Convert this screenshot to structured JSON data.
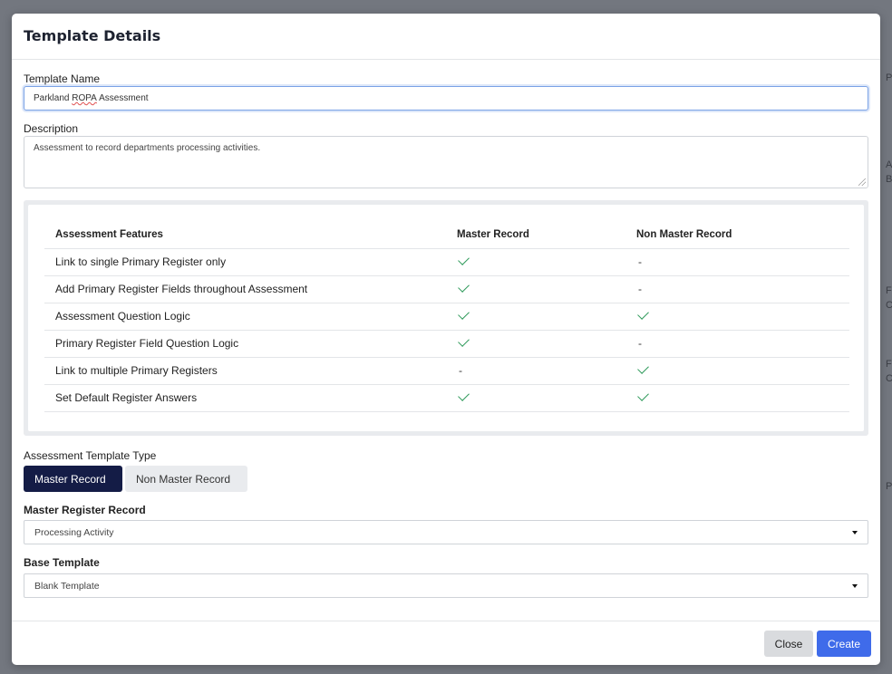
{
  "modal": {
    "title": "Template Details"
  },
  "template_name": {
    "label": "Template Name",
    "value_pre": "Parkland ",
    "value_spell": "ROPA",
    "value_post": " Assessment"
  },
  "description": {
    "label": "Description",
    "value": "Assessment to record departments processing activities."
  },
  "features": {
    "headers": [
      "Assessment Features",
      "Master Record",
      "Non Master Record"
    ],
    "rows": [
      {
        "feature": "Link to single Primary Register only",
        "master": "check",
        "non_master": "-"
      },
      {
        "feature": "Add Primary Register Fields throughout Assessment",
        "master": "check",
        "non_master": "-"
      },
      {
        "feature": "Assessment Question Logic",
        "master": "check",
        "non_master": "check"
      },
      {
        "feature": "Primary Register Field Question Logic",
        "master": "check",
        "non_master": "-"
      },
      {
        "feature": "Link to multiple Primary Registers",
        "master": "-",
        "non_master": "check"
      },
      {
        "feature": "Set Default Register Answers",
        "master": "check",
        "non_master": "check"
      }
    ]
  },
  "template_type": {
    "label": "Assessment Template Type",
    "options": [
      "Master Record",
      "Non Master Record"
    ],
    "selected": "Master Record"
  },
  "master_register_record": {
    "label": "Master Register Record",
    "value": "Processing Activity"
  },
  "base_template": {
    "label": "Base Template",
    "value": "Blank Template"
  },
  "footer": {
    "close_label": "Close",
    "create_label": "Create"
  },
  "colors": {
    "primary_dark": "#141c46",
    "primary_blue": "#3f6bea",
    "check_green": "#2e9a5a"
  }
}
